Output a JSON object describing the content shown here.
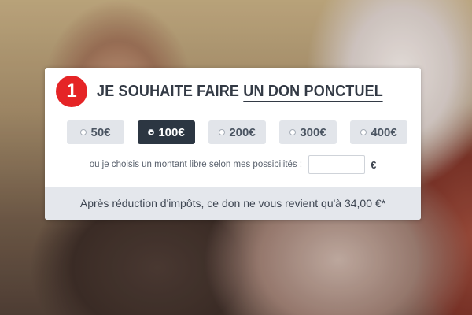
{
  "form": {
    "step_number": "1",
    "title_prefix": "JE SOUHAITE FAIRE ",
    "title_emphasis": "UN DON PONCTUEL",
    "amounts": [
      {
        "label": "50€",
        "selected": false
      },
      {
        "label": "100€",
        "selected": true
      },
      {
        "label": "200€",
        "selected": false
      },
      {
        "label": "300€",
        "selected": false
      },
      {
        "label": "400€",
        "selected": false
      }
    ],
    "free_amount_label": "ou je choisis un montant libre selon mes possibilités :",
    "free_amount_value": "",
    "currency_symbol": "€",
    "tax_note": "Après réduction d'impôts, ce don ne vous revient qu'à 34,00 €*"
  },
  "colors": {
    "badge": "#e52426",
    "selected_button": "#2c3642",
    "button": "#e2e5ea",
    "footer": "#e4e7ec"
  }
}
